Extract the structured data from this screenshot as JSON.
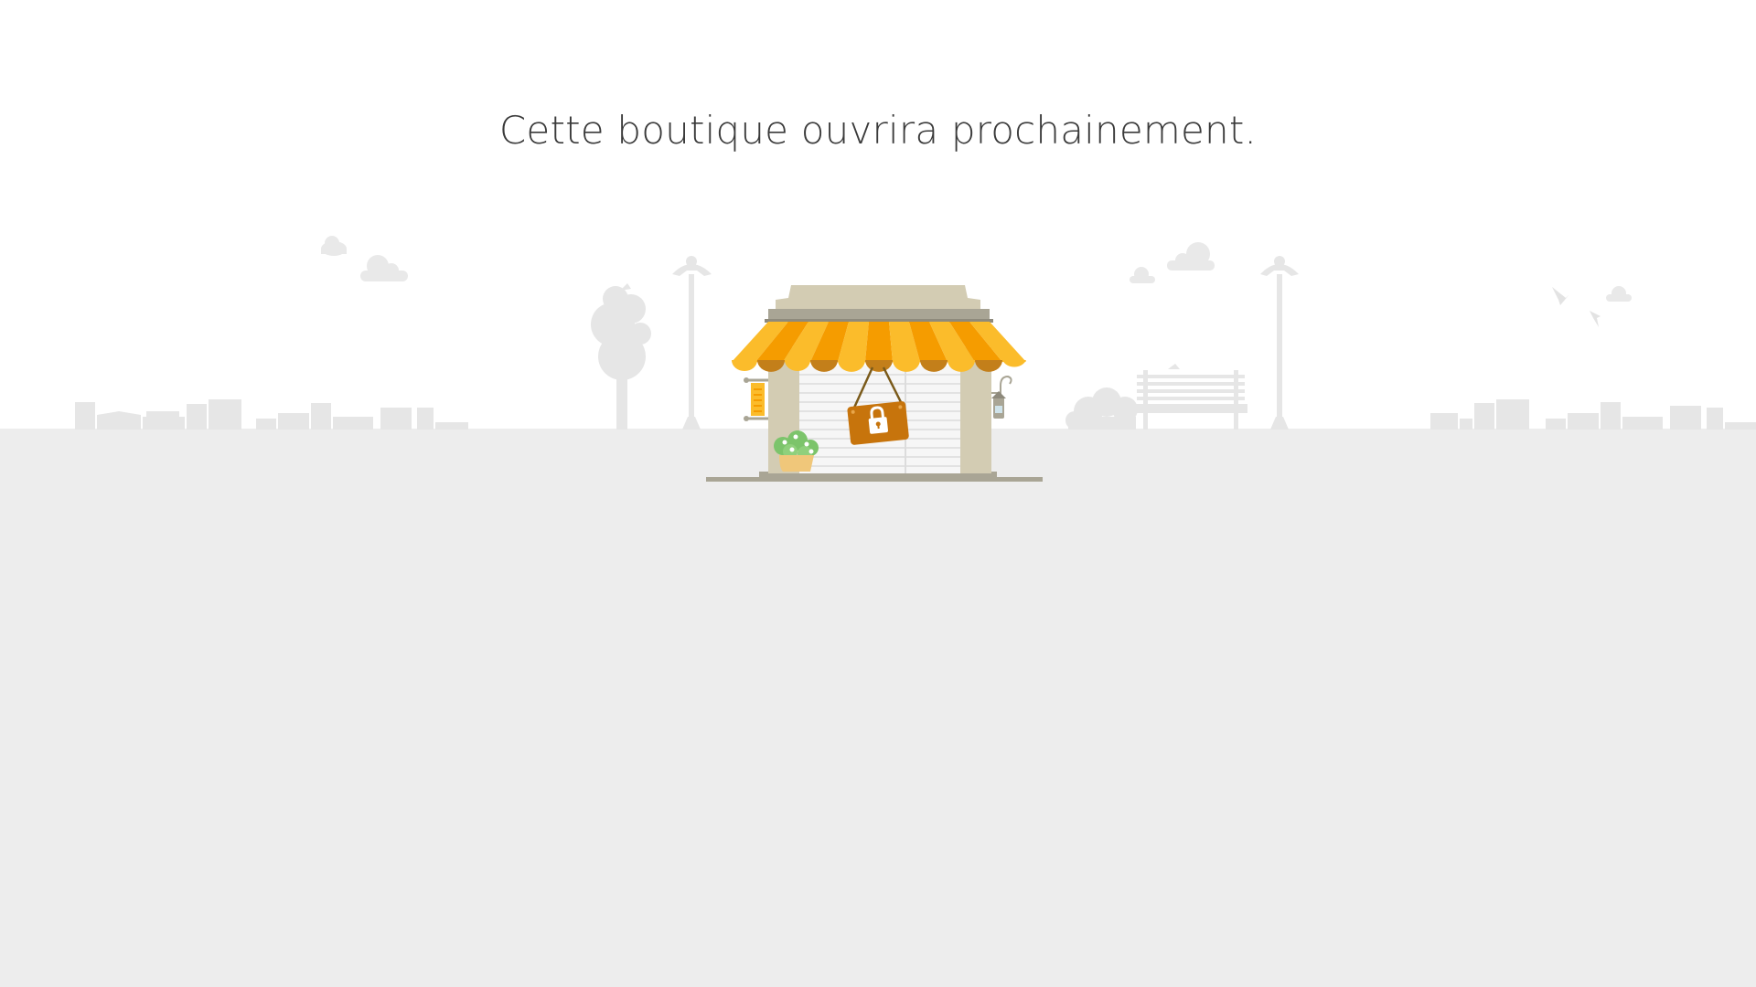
{
  "page": {
    "message": "Cette boutique ouvrira prochainement.",
    "colors": {
      "background": "#ffffff",
      "ground": "#ededed",
      "silhouette": "#e6e6e6",
      "awning_yellow": "#fbbc2b",
      "awning_orange": "#f59c00",
      "scallop_dark": "#c37f1a",
      "shop_beige": "#d3ccb3",
      "shop_roof_band": "#a9a595",
      "sign_orange": "#c7740c",
      "plant_green": "#7cc46b",
      "pot_tan": "#f0c77a",
      "text": "#3a3a3a"
    },
    "icons": {
      "sign": "padlock-icon",
      "scene": "storefront-illustration"
    }
  }
}
